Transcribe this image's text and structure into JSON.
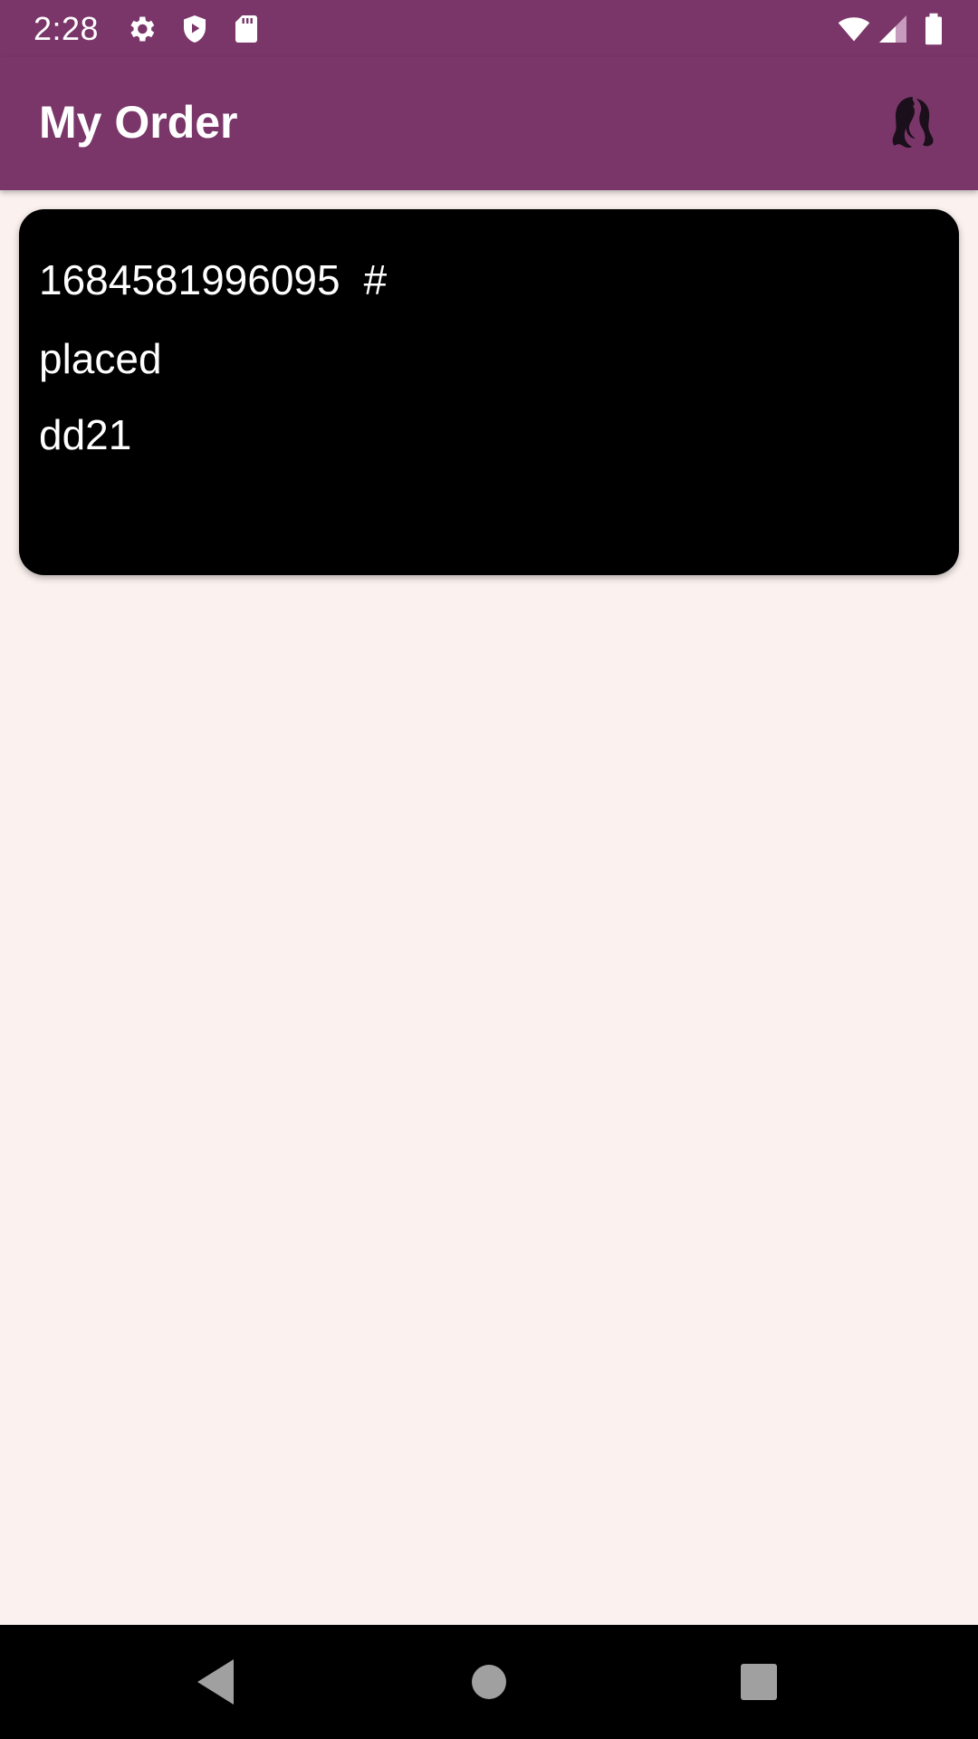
{
  "status_bar": {
    "time": "2:28",
    "icons": [
      "settings-icon",
      "shield-play-icon",
      "sd-card-icon",
      "wifi-icon",
      "signal-icon",
      "battery-icon"
    ]
  },
  "app_bar": {
    "title": "My Order",
    "logo_icon": "hair-silhouette-icon",
    "background_color": "#7a3669"
  },
  "orders": [
    {
      "id": "1684581996095",
      "id_suffix": "#",
      "status": "placed",
      "code": "dd21"
    }
  ],
  "nav_bar": {
    "buttons": [
      "back-icon",
      "home-icon",
      "recents-icon"
    ]
  },
  "colors": {
    "accent": "#7a3669",
    "background": "#fbf1ee",
    "card": "#000000"
  }
}
